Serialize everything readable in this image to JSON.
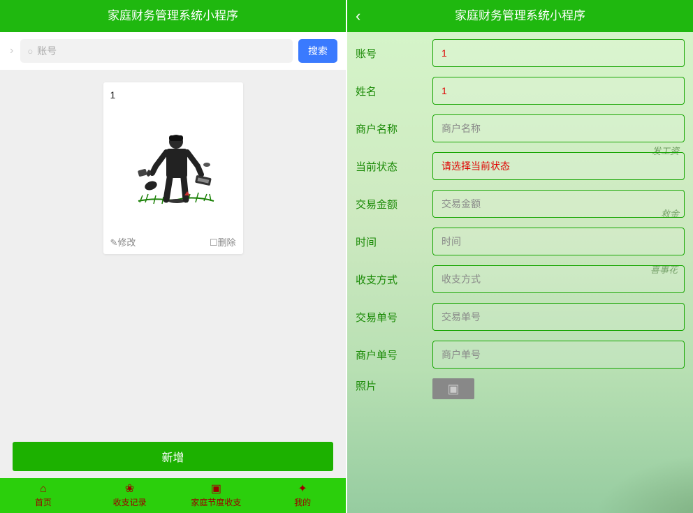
{
  "left": {
    "title": "家庭财务管理系统小程序",
    "search": {
      "placeholder": "账号",
      "button": "搜索"
    },
    "card": {
      "id": "1",
      "edit": "✎修改",
      "delete": "☐删除"
    },
    "add_button": "新增",
    "tabs": [
      {
        "icon": "⌂",
        "label": "首页"
      },
      {
        "icon": "❀",
        "label": "收支记录"
      },
      {
        "icon": "▣",
        "label": "家庭节度收支"
      },
      {
        "icon": "✦",
        "label": "我的"
      }
    ]
  },
  "right": {
    "title": "家庭财务管理系统小程序",
    "fields": [
      {
        "label": "账号",
        "value": "1",
        "type": "value"
      },
      {
        "label": "姓名",
        "value": "1",
        "type": "value"
      },
      {
        "label": "商户名称",
        "value": "商户名称",
        "type": "placeholder"
      },
      {
        "label": "当前状态",
        "value": "请选择当前状态",
        "type": "danger"
      },
      {
        "label": "交易金额",
        "value": "交易金额",
        "type": "placeholder"
      },
      {
        "label": "时间",
        "value": "时间",
        "type": "placeholder"
      },
      {
        "label": "收支方式",
        "value": "收支方式",
        "type": "placeholder"
      },
      {
        "label": "交易单号",
        "value": "交易单号",
        "type": "placeholder"
      },
      {
        "label": "商户单号",
        "value": "商户单号",
        "type": "placeholder"
      }
    ],
    "photo_label": "照片",
    "decorations": [
      "发工资",
      "救金",
      "喜事花"
    ]
  }
}
